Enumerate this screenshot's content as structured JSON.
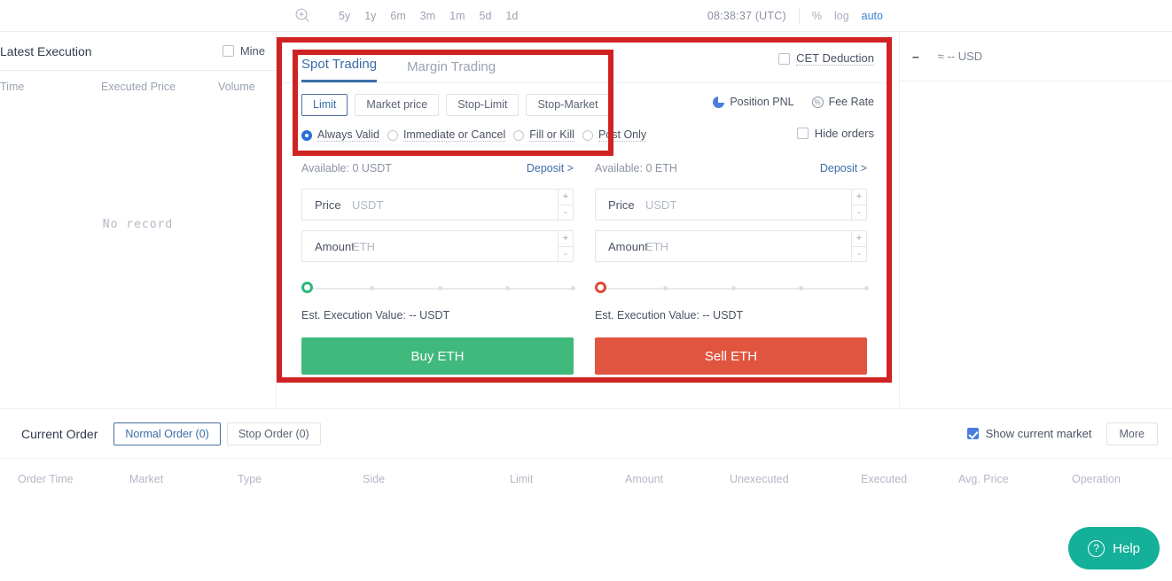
{
  "chart_toolbar": {
    "zoom_icon": "zoom-in-icon",
    "timeframes": [
      "5y",
      "1y",
      "6m",
      "3m",
      "1m",
      "5d",
      "1d"
    ],
    "clock": "08:38:37 (UTC)",
    "scale_options": [
      "%",
      "log",
      "auto"
    ],
    "active_scale": "auto"
  },
  "latest_execution": {
    "title": "Latest Execution",
    "mine_label": "Mine",
    "mine_checked": false,
    "columns": [
      "Time",
      "Executed Price",
      "Volume"
    ],
    "empty_text": "No  record"
  },
  "right_panel": {
    "value": "--",
    "approx": "≈ -- USD"
  },
  "trading": {
    "tabs": [
      {
        "label": "Spot Trading",
        "active": true
      },
      {
        "label": "Margin Trading",
        "active": false
      }
    ],
    "order_types": [
      {
        "label": "Limit",
        "active": true
      },
      {
        "label": "Market price",
        "active": false
      },
      {
        "label": "Stop-Limit",
        "active": false
      },
      {
        "label": "Stop-Market",
        "active": false
      }
    ],
    "validity": [
      {
        "label": "Always Valid",
        "selected": true
      },
      {
        "label": "Immediate or Cancel",
        "selected": false
      },
      {
        "label": "Fill or Kill",
        "selected": false
      },
      {
        "label": "Post Only",
        "selected": false
      }
    ],
    "cet_deduction": {
      "label": "CET Deduction",
      "checked": false
    },
    "position_pnl": "Position PNL",
    "fee_rate": "Fee Rate",
    "hide_orders": {
      "label": "Hide orders",
      "checked": false
    },
    "buy": {
      "available": "Available: 0 USDT",
      "deposit": "Deposit >",
      "price_label": "Price",
      "price_value": "",
      "price_placeholder": "USDT",
      "amount_label": "Amount",
      "amount_value": "",
      "amount_placeholder": "ETH",
      "est": "Est. Execution Value: -- USDT",
      "action": "Buy ETH",
      "slider_percent": 0
    },
    "sell": {
      "available": "Available: 0 ETH",
      "deposit": "Deposit >",
      "price_label": "Price",
      "price_value": "",
      "price_placeholder": "USDT",
      "amount_label": "Amount",
      "amount_value": "",
      "amount_placeholder": "ETH",
      "est": "Est. Execution Value: -- USDT",
      "action": "Sell ETH",
      "slider_percent": 0
    }
  },
  "orders": {
    "title": "Current Order",
    "tabs": [
      {
        "label": "Normal Order (0)",
        "active": true
      },
      {
        "label": "Stop Order (0)",
        "active": false
      }
    ],
    "show_current_market": {
      "label": "Show current market",
      "checked": true
    },
    "more": "More",
    "columns": [
      "Order Time",
      "Market",
      "Type",
      "Side",
      "Limit",
      "Amount",
      "Unexecuted",
      "Executed",
      "Avg. Price",
      "Operation"
    ]
  },
  "help": {
    "label": "Help",
    "icon": "question-circle-icon"
  },
  "colors": {
    "accent_blue": "#3a6ea8",
    "buy_green": "#3fb97c",
    "sell_red": "#e15540",
    "highlight_red": "#cf2222",
    "help_teal": "#14b09a"
  }
}
